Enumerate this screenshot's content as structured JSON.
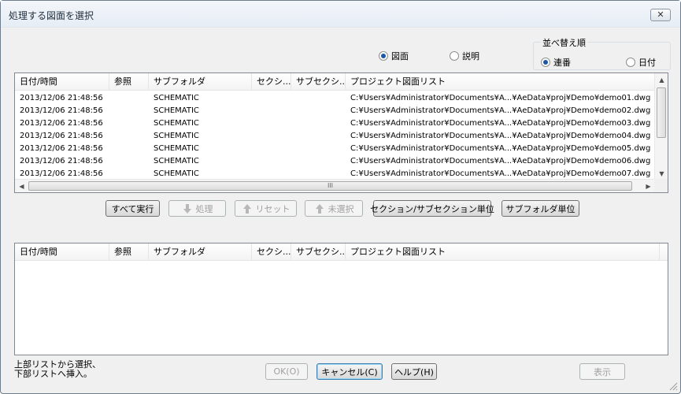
{
  "window": {
    "title": "処理する図面を選択",
    "close_label": "✕"
  },
  "display_mode": {
    "options": [
      {
        "label": "図面",
        "selected": true
      },
      {
        "label": "説明",
        "selected": false
      }
    ]
  },
  "sort": {
    "label": "並べ替え順",
    "options": [
      {
        "label": "連番",
        "selected": true
      },
      {
        "label": "日付",
        "selected": false
      }
    ]
  },
  "top_list": {
    "columns": [
      "日付/時間",
      "参照",
      "サブフォルダ",
      "セクシ...",
      "サブセクシ...",
      "プロジェクト図面リスト"
    ],
    "rows": [
      [
        "2013/12/06 21:48:56",
        "",
        "SCHEMATIC",
        "",
        "",
        "C:¥Users¥Administrator¥Documents¥A...¥AeData¥proj¥Demo¥demo01.dwg"
      ],
      [
        "2013/12/06 21:48:56",
        "",
        "SCHEMATIC",
        "",
        "",
        "C:¥Users¥Administrator¥Documents¥A...¥AeData¥proj¥Demo¥demo02.dwg"
      ],
      [
        "2013/12/06 21:48:56",
        "",
        "SCHEMATIC",
        "",
        "",
        "C:¥Users¥Administrator¥Documents¥A...¥AeData¥proj¥Demo¥demo03.dwg"
      ],
      [
        "2013/12/06 21:48:56",
        "",
        "SCHEMATIC",
        "",
        "",
        "C:¥Users¥Administrator¥Documents¥A...¥AeData¥proj¥Demo¥demo04.dwg"
      ],
      [
        "2013/12/06 21:48:56",
        "",
        "SCHEMATIC",
        "",
        "",
        "C:¥Users¥Administrator¥Documents¥A...¥AeData¥proj¥Demo¥demo05.dwg"
      ],
      [
        "2013/12/06 21:48:56",
        "",
        "SCHEMATIC",
        "",
        "",
        "C:¥Users¥Administrator¥Documents¥A...¥AeData¥proj¥Demo¥demo06.dwg"
      ],
      [
        "2013/12/06 21:48:56",
        "",
        "SCHEMATIC",
        "",
        "",
        "C:¥Users¥Administrator¥Documents¥A...¥AeData¥proj¥Demo¥demo07.dwg"
      ]
    ],
    "hscroll_grip": "III"
  },
  "actions": {
    "run_all": "すべて実行",
    "process": "処理",
    "reset": "リセット",
    "unselected": "未選択",
    "by_section": "セクション/サブセクション単位",
    "by_subfolder": "サブフォルダ単位"
  },
  "bottom_list": {
    "columns": [
      "日付/時間",
      "参照",
      "サブフォルダ",
      "セクシ...",
      "サブセクシ...",
      "プロジェクト図面リスト"
    ]
  },
  "footer": {
    "note_line1": "上部リストから選択、",
    "note_line2": "下部リストへ挿入。",
    "ok": "OK(O)",
    "cancel": "キャンセル(C)",
    "help": "ヘルプ(H)",
    "show": "表示"
  }
}
